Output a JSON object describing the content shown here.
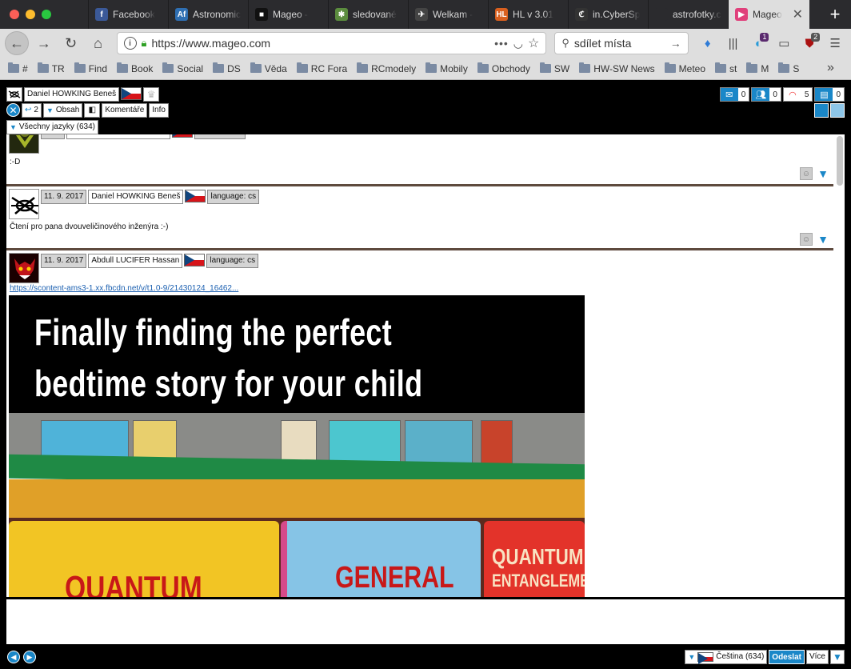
{
  "browser": {
    "tabs": [
      {
        "label": "Facebook",
        "icon": "facebook-icon",
        "color": "#3b5998",
        "glyph": "f"
      },
      {
        "label": "Astronomic",
        "icon": "astronomic-icon",
        "color": "#2f6fb2",
        "glyph": "Af"
      },
      {
        "label": "Mageo - ",
        "icon": "mageo-black-icon",
        "color": "#111111",
        "glyph": "■"
      },
      {
        "label": "sledované",
        "icon": "sledovane-icon",
        "color": "#5b8c3e",
        "glyph": "✱"
      },
      {
        "label": "Welkam - ",
        "icon": "welkam-icon",
        "color": "#444444",
        "glyph": "✈"
      },
      {
        "label": "HL v 3.01",
        "icon": "hl-icon",
        "color": "#d9601f",
        "glyph": "HL"
      },
      {
        "label": "in.CyberSp",
        "icon": "cyberspace-icon",
        "color": "#333333",
        "glyph": "ℭ"
      },
      {
        "label": "astrofotky.cz",
        "icon": "astrofotky-icon",
        "color": "#2b2b2e",
        "glyph": ""
      },
      {
        "label": "Mageo",
        "icon": "mageo-color-icon",
        "color": "#e0407b",
        "glyph": "▶"
      }
    ],
    "url": "https://www.mageo.com",
    "search_placeholder": "sdílet místa",
    "badge_count_1": "1",
    "badge_count_2": "2",
    "bookmarks": [
      "#",
      "TR",
      "Find",
      "Book",
      "Social",
      "DS",
      "Věda",
      "RC Fora",
      "RCmodely",
      "Mobily",
      "Obchody",
      "SW",
      "HW-SW News",
      "Meteo",
      "st",
      "M",
      "S"
    ]
  },
  "app": {
    "user": {
      "name": "Daniel HOWKING Beneš"
    },
    "stats": {
      "messages": "0",
      "friends": "0",
      "signal": "5",
      "counter": "0"
    },
    "toolbar": {
      "reply_count": "2",
      "content_label": "Obsah",
      "comments_label": "Komentáře",
      "info_label": "Info"
    },
    "language_filter": "Všechny jazyky (634)",
    "posts": [
      {
        "text": ":-D"
      },
      {
        "date": "11. 9. 2017",
        "author": "Daniel HOWKING Beneš",
        "language": "language: cs",
        "text": "Čtení pro pana dvouveličinového inženýra :-)"
      },
      {
        "date": "11. 9. 2017",
        "author": "Abdull LUCIFER Hassan",
        "language": "language: cs",
        "link": "https://scontent-ams3-1.xx.fbcdn.net/v/t1.0-9/21430124_16462...",
        "image": {
          "caption_line1": "Finally finding the perfect",
          "caption_line2": "bedtime story for your child",
          "book1": "QUANTUM",
          "book2": "GENERAL",
          "book3_line1": "QUANTUM",
          "book3_line2": "ENTANGLEME"
        }
      }
    ],
    "bottom": {
      "language": "Čeština (634)",
      "send_label": "Odeslat",
      "more_label": "Více"
    }
  }
}
